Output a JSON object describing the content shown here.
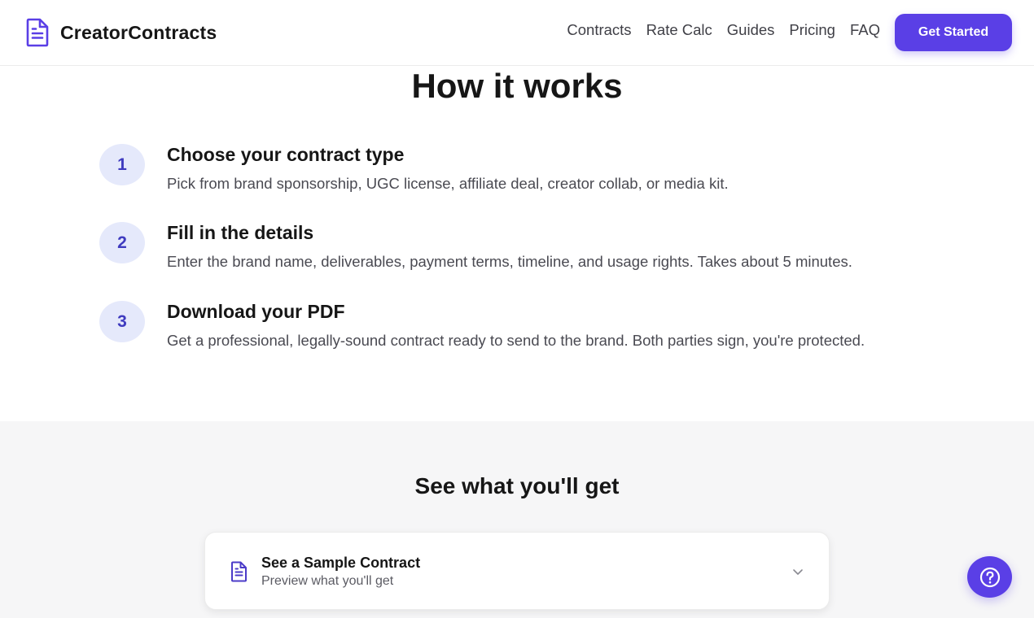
{
  "brand": {
    "name": "CreatorContracts",
    "icon": "document-icon",
    "accent": "#5a3fe6"
  },
  "nav": {
    "links": [
      "Contracts",
      "Rate Calc",
      "Guides",
      "Pricing",
      "FAQ"
    ],
    "cta": "Get Started"
  },
  "how_it_works": {
    "title": "How it works",
    "steps": [
      {
        "num": "1",
        "title": "Choose your contract type",
        "desc": "Pick from brand sponsorship, UGC license, affiliate deal, creator collab, or media kit."
      },
      {
        "num": "2",
        "title": "Fill in the details",
        "desc": "Enter the brand name, deliverables, payment terms, timeline, and usage rights. Takes about 5 minutes."
      },
      {
        "num": "3",
        "title": "Download your PDF",
        "desc": "Get a professional, legally-sound contract ready to send to the brand. Both parties sign, you're protected."
      }
    ]
  },
  "preview": {
    "title": "See what you'll get",
    "card": {
      "title": "See a Sample Contract",
      "subtitle": "Preview what you'll get",
      "icon": "document-icon",
      "toggle_icon": "chevron-down-icon"
    }
  },
  "help": {
    "icon": "help-circle-icon"
  }
}
